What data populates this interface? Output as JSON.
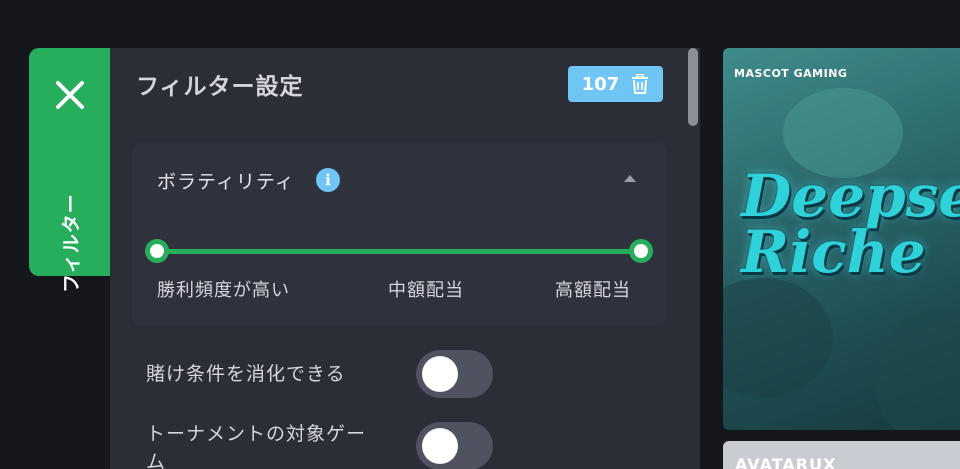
{
  "filter_tab": {
    "label": "フィルター",
    "close_icon": "close-icon"
  },
  "panel": {
    "title": "フィルター設定",
    "result_count": "107",
    "clear_icon": "trash-icon"
  },
  "volatility": {
    "title": "ボラティリティ",
    "info_icon": "info-icon",
    "info_glyph": "i",
    "collapse_icon": "chevron-up-icon",
    "range_min_fraction": 0,
    "range_max_fraction": 1,
    "labels": {
      "low": "勝利頻度が高い",
      "mid": "中額配当",
      "high": "高額配当"
    }
  },
  "toggles": [
    {
      "label": "賭け条件を消化できる",
      "on": false
    },
    {
      "label": "トーナメントの対象ゲー\nム",
      "on": false
    }
  ],
  "games": [
    {
      "provider": "MASCOT GAMING",
      "art_title": "Deepse\nRiche"
    },
    {
      "provider": "AVATARUX"
    }
  ],
  "colors": {
    "accent_green": "#27ae5c",
    "badge_blue": "#6fc6f4",
    "panel_bg": "#2b2d37",
    "page_bg": "#16171d"
  }
}
